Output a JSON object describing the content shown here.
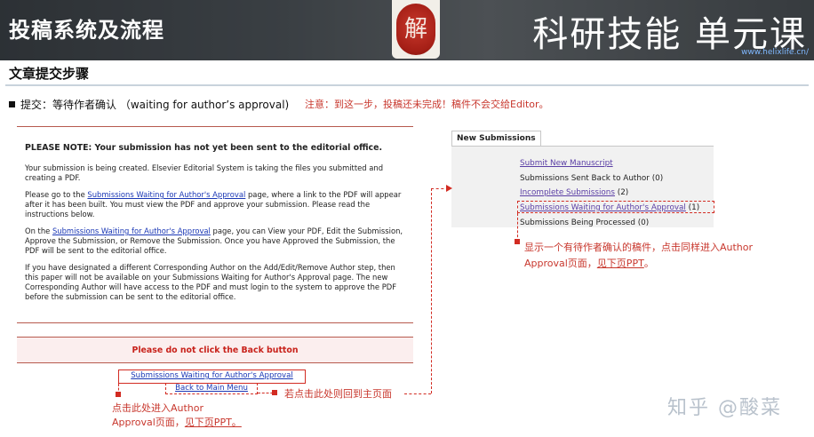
{
  "header": {
    "title_left": "投稿系统及流程",
    "title_right": "科研技能 单元课",
    "url": "www.helixlife.cn/",
    "seal_char": "解"
  },
  "section": {
    "title": "文章提交步骤",
    "step": "提交：等待作者确认 （waiting for author’s approval)",
    "note": "注意：到这一步，投稿还未完成！稿件不会交给Editor。"
  },
  "left_panel": {
    "note_head": "PLEASE NOTE: Your submission has not yet been sent to the editorial office.",
    "para1": "Your submission is being created. Elsevier Editorial System is taking the files you submitted and creating a PDF.",
    "para2_a": "Please go to the ",
    "para2_link": "Submissions Waiting for Author's Approval",
    "para2_b": " page, where a link to the PDF will appear after it has been built. You must view the PDF and approve your submission. Please read the instructions below.",
    "para3_a": "On the ",
    "para3_link": "Submissions Waiting for Author's Approval",
    "para3_b": " page, you can View your PDF, Edit the Submission, Approve the Submission, or Remove the Submission. Once you have Approved the Submission, the PDF will be sent to the editorial office.",
    "para4": "If you have designated a different Corresponding Author on the Add/Edit/Remove Author step, then this paper will not be available on your Submissions Waiting for Author's Approval page. The new Corresponding Author will have access to the PDF and must login to the system to approve the PDF before the submission can be sent to the editorial office.",
    "back_warning": "Please do not click the Back button",
    "link_waiting": "Submissions Waiting for Author's Approval",
    "link_main": "Back to Main Menu"
  },
  "right_panel": {
    "tab": "New Submissions",
    "items": [
      {
        "label": "Submit New Manuscript",
        "count": ""
      },
      {
        "label": "Submissions Sent Back to Author",
        "count": " (0)"
      },
      {
        "label": "Incomplete Submissions",
        "count": " (2)"
      },
      {
        "label": "Submissions Waiting for Author's Approval",
        "count": " (1)"
      },
      {
        "label": "Submissions Being Processed",
        "count": " (0)"
      }
    ]
  },
  "annotations": {
    "right_line1": "显示一个有待作者确认的稿件，点击同样进入Author",
    "right_line2a": "Approval页面，",
    "right_line2b": "见下页PPT",
    "right_line2c": "。",
    "left_line1": "点击此处进入Author",
    "left_line2a": "Approval页面，",
    "left_line2b": "见下页PPT。",
    "middle": "若点击此处则回到主页面"
  },
  "watermark": "知乎 @酸菜",
  "colors": {
    "accent_red": "#c8372d",
    "link_blue": "#1a37b5",
    "panel_rule": "#b75a4e"
  }
}
